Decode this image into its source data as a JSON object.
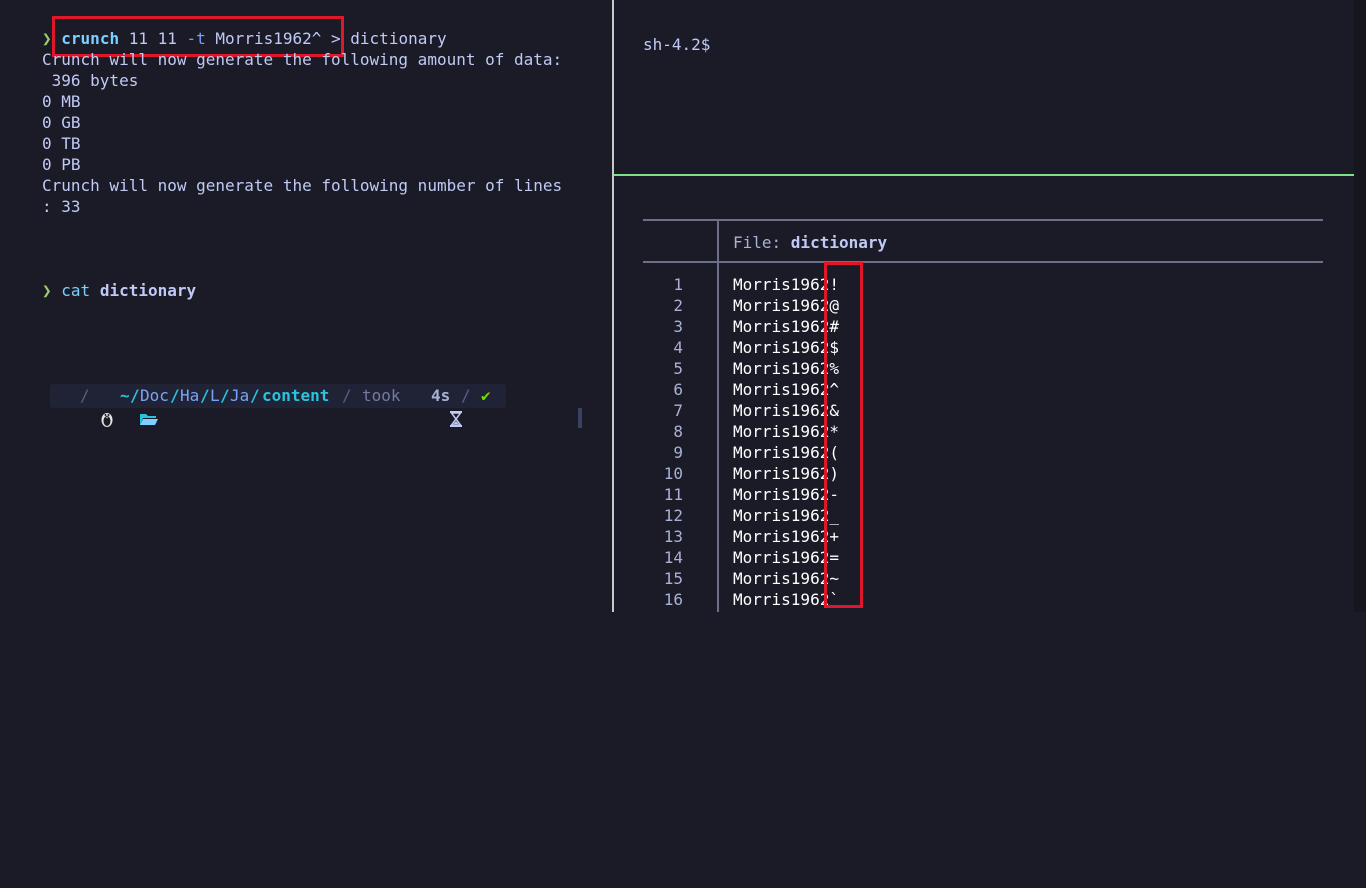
{
  "left_terminal": {
    "prompt_symbol": "❯",
    "cmd1": {
      "program": "crunch",
      "args1": " 11 11 ",
      "flag": "-t",
      "args2": " Morris1962^ ",
      "redirect": "> dictionary"
    },
    "output": [
      "Crunch will now generate the following amount of data:",
      " 396 bytes",
      "0 MB",
      "0 GB",
      "0 TB",
      "0 PB",
      "Crunch will now generate the following number of lines",
      ": 33"
    ],
    "cmd2": {
      "program": "cat",
      "arg": "dictionary"
    },
    "status_bar": {
      "os_icon": "linux-penguin-icon",
      "sep": "/",
      "folder_icon": "open-folder-icon",
      "path_home": "~",
      "path_parts": [
        "Doc",
        "Ha",
        "L",
        "Ja"
      ],
      "path_current": "content",
      "took_label": "took",
      "hourglass_icon": "hourglass-icon",
      "duration": "4s",
      "status": "✔"
    }
  },
  "right_top_terminal": {
    "prompt": "sh-4.2$"
  },
  "bat_viewer": {
    "file_label": "File: ",
    "file_name": "dictionary",
    "lines": [
      {
        "n": "1",
        "text": "Morris1962!"
      },
      {
        "n": "2",
        "text": "Morris1962@"
      },
      {
        "n": "3",
        "text": "Morris1962#"
      },
      {
        "n": "4",
        "text": "Morris1962$"
      },
      {
        "n": "5",
        "text": "Morris1962%"
      },
      {
        "n": "6",
        "text": "Morris1962^"
      },
      {
        "n": "7",
        "text": "Morris1962&"
      },
      {
        "n": "8",
        "text": "Morris1962*"
      },
      {
        "n": "9",
        "text": "Morris1962("
      },
      {
        "n": "10",
        "text": "Morris1962)"
      },
      {
        "n": "11",
        "text": "Morris1962-"
      },
      {
        "n": "12",
        "text": "Morris1962_"
      },
      {
        "n": "13",
        "text": "Morris1962+"
      },
      {
        "n": "14",
        "text": "Morris1962="
      },
      {
        "n": "15",
        "text": "Morris1962~"
      },
      {
        "n": "16",
        "text": "Morris1962`"
      }
    ]
  },
  "colors": {
    "background": "#1a1b26",
    "annotation_red": "#e0162b",
    "pane_active_border": "#7fe08a",
    "prompt_green": "#9ece6a"
  }
}
